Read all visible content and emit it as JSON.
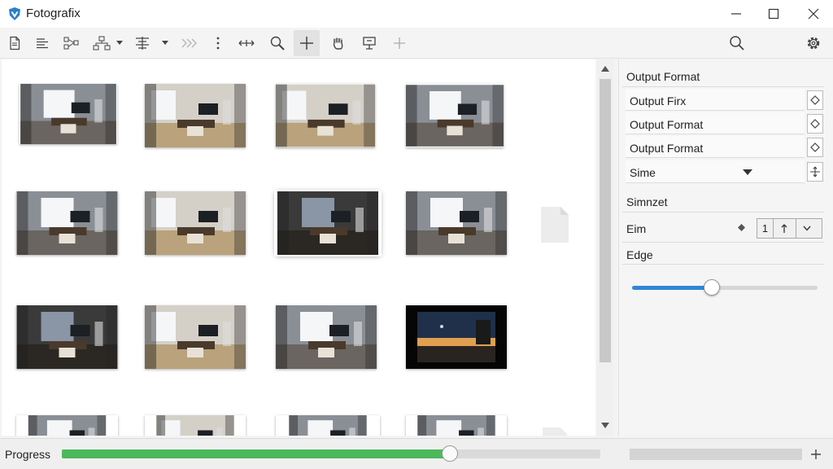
{
  "app": {
    "title": "Fotografix"
  },
  "window_controls": [
    "minimize-icon",
    "maximize-icon",
    "close-icon"
  ],
  "toolbar": {
    "icons": [
      "new-document-icon",
      "align-icon",
      "flow-icon",
      "hierarchy-icon",
      "chevron-down-icon",
      "distribute-icon",
      "chevron-down-icon",
      "fast-forward-icon",
      "more-vertical-icon",
      "move-icon",
      "zoom-icon",
      "add-icon",
      "hand-icon",
      "export-icon",
      "crosshair-icon"
    ],
    "active_icon": "add-icon",
    "right_icons": [
      "search-icon",
      "settings-icon"
    ]
  },
  "gallery": {
    "item_count": 16,
    "selected_index": 6
  },
  "panel": {
    "title": "Output Format",
    "rows": [
      {
        "label": "Output Firx",
        "control": "diamond-icon"
      },
      {
        "label": "Output Format",
        "control": "diamond-icon"
      },
      {
        "label": "Output Format",
        "control": "diamond-icon"
      },
      {
        "label": "Sime",
        "control": "move-icon"
      }
    ],
    "section_label": "Simnzet",
    "eim": {
      "label": "Eim",
      "stepper_value": "1"
    },
    "edge": {
      "label": "Edge",
      "slider_value": 0.43
    }
  },
  "status": {
    "progress_label": "Progress",
    "progress_value": 0.72
  },
  "colors": {
    "accent": "#2f86d6",
    "progress": "#4cb85c"
  }
}
